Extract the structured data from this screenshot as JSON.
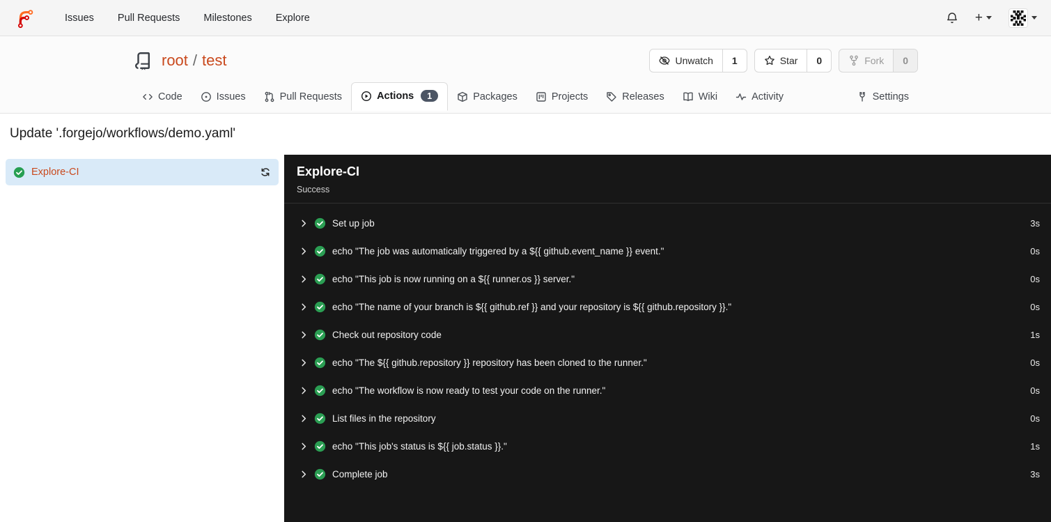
{
  "colors": {
    "accent_link": "#c9491d",
    "success_green": "#2b9e53",
    "panel_bg": "#171717",
    "active_job_bg": "#d9eaf8",
    "badge_bg": "#4c5564",
    "navbar_bg": "#f5f5f5"
  },
  "navbar": {
    "items": [
      "Issues",
      "Pull Requests",
      "Milestones",
      "Explore"
    ]
  },
  "repo": {
    "owner": "root",
    "separator": "/",
    "name": "test",
    "buttons": {
      "watch": {
        "label": "Unwatch",
        "count": "1"
      },
      "star": {
        "label": "Star",
        "count": "0"
      },
      "fork": {
        "label": "Fork",
        "count": "0",
        "disabled": true
      }
    }
  },
  "tabs": [
    {
      "label": "Code"
    },
    {
      "label": "Issues"
    },
    {
      "label": "Pull Requests"
    },
    {
      "label": "Actions",
      "badge": "1",
      "active": true
    },
    {
      "label": "Packages"
    },
    {
      "label": "Projects"
    },
    {
      "label": "Releases"
    },
    {
      "label": "Wiki"
    },
    {
      "label": "Activity"
    },
    {
      "label": "Settings"
    }
  ],
  "run": {
    "title": "Update '.forgejo/workflows/demo.yaml'"
  },
  "sidebar": {
    "jobs": [
      {
        "name": "Explore-CI",
        "status": "success"
      }
    ]
  },
  "job_panel": {
    "title": "Explore-CI",
    "status_text": "Success",
    "steps": [
      {
        "name": "Set up job",
        "duration": "3s"
      },
      {
        "name": "echo \"The job was automatically triggered by a ${{ github.event_name }} event.\"",
        "duration": "0s"
      },
      {
        "name": "echo \"This job is now running on a ${{ runner.os }} server.\"",
        "duration": "0s"
      },
      {
        "name": "echo \"The name of your branch is ${{ github.ref }} and your repository is ${{ github.repository }}.\"",
        "duration": "0s"
      },
      {
        "name": "Check out repository code",
        "duration": "1s"
      },
      {
        "name": "echo \"The ${{ github.repository }} repository has been cloned to the runner.\"",
        "duration": "0s"
      },
      {
        "name": "echo \"The workflow is now ready to test your code on the runner.\"",
        "duration": "0s"
      },
      {
        "name": "List files in the repository",
        "duration": "0s"
      },
      {
        "name": "echo \"This job's status is ${{ job.status }}.\"",
        "duration": "1s"
      },
      {
        "name": "Complete job",
        "duration": "3s"
      }
    ]
  }
}
